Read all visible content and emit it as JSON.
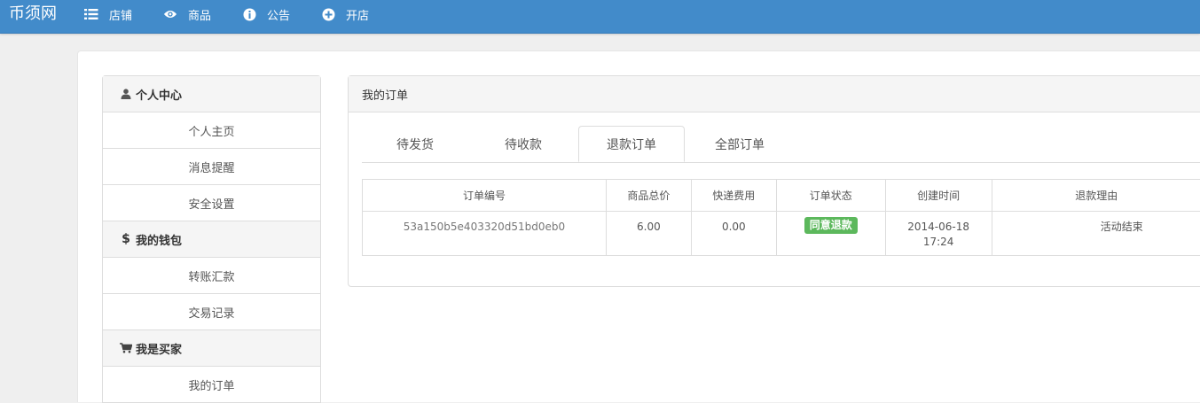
{
  "navbar": {
    "brand": "币须网",
    "items": [
      {
        "label": "店铺",
        "icon": "list-icon"
      },
      {
        "label": "商品",
        "icon": "eye-icon"
      },
      {
        "label": "公告",
        "icon": "info-circle-icon"
      },
      {
        "label": "开店",
        "icon": "plus-circle-icon"
      }
    ]
  },
  "sidebar": {
    "sections": [
      {
        "title": "个人中心",
        "icon": "user-icon",
        "items": [
          "个人主页",
          "消息提醒",
          "安全设置"
        ]
      },
      {
        "title": "我的钱包",
        "icon": "dollar-icon",
        "items": [
          "转账汇款",
          "交易记录"
        ]
      },
      {
        "title": "我是买家",
        "icon": "cart-icon",
        "items": [
          "我的订单"
        ]
      }
    ]
  },
  "panel": {
    "title": "我的订单",
    "tabs": [
      "待发货",
      "待收款",
      "退款订单",
      "全部订单"
    ],
    "active_tab": "退款订单",
    "table": {
      "headers": [
        "订单编号",
        "商品总价",
        "快递费用",
        "订单状态",
        "创建时间",
        "退款理由"
      ],
      "rows": [
        {
          "order_id": "53a150b5e403320d51bd0eb0",
          "total": "6.00",
          "shipping": "0.00",
          "status": "同意退款",
          "date": "2014-06-18",
          "time": "17:24",
          "reason": "活动结束"
        }
      ]
    }
  },
  "colors": {
    "navbar": "#428bca",
    "status_success": "#5cb85c"
  }
}
